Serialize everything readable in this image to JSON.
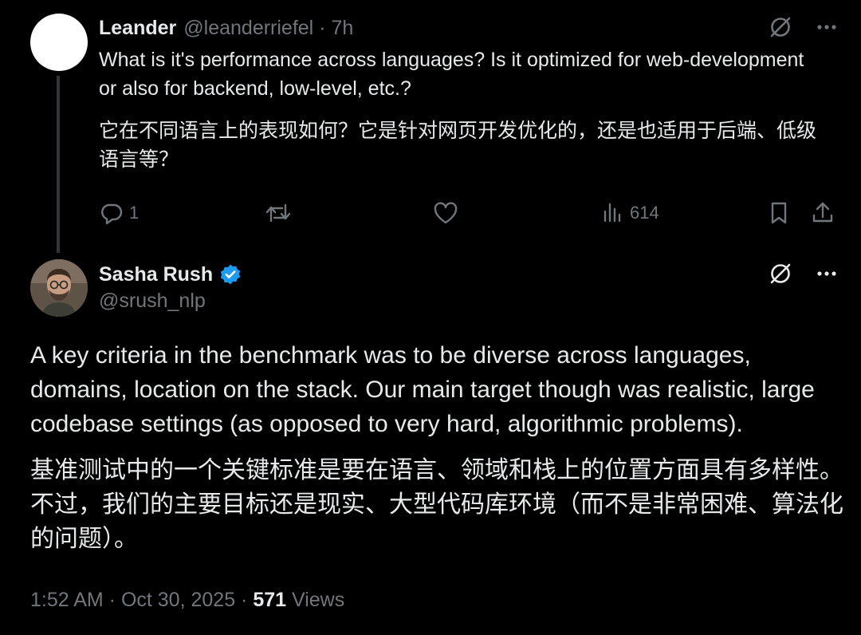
{
  "reply": {
    "author_name": "Leander",
    "author_meta": "@leanderriefel · 7h",
    "text_en": "What is it's performance across languages? Is it optimized for web-development or also for backend, low-level, etc.?",
    "text_zh": "它在不同语言上的表现如何？它是针对网页开发优化的，还是也适用于后端、低级语言等？",
    "actions": {
      "reply_count": "1",
      "retweet_count": "",
      "like_count": "",
      "views_count": "614"
    }
  },
  "tweet": {
    "author_name": "Sasha Rush",
    "author_handle": "@srush_nlp",
    "verified": true,
    "text_en": "A key criteria in the benchmark was to be diverse across languages, domains, location on the stack. Our main target though was realistic, large codebase settings (as opposed to very hard, algorithmic problems).",
    "text_zh": "基准测试中的一个关键标准是要在语言、领域和栈上的位置方面具有多样性。不过，我们的主要目标还是现实、大型代码库环境（而不是非常困难、算法化的问题）。",
    "meta_prefix": "1:52 AM · Oct 30, 2025 · ",
    "views_count": "571",
    "views_label": " Views"
  },
  "icons": {
    "grok": "grok-slash-icon",
    "more": "more-horizontal-icon",
    "reply": "reply-bubble-icon",
    "retweet": "retweet-icon",
    "like": "heart-icon",
    "views": "views-chart-icon",
    "bookmark": "bookmark-icon",
    "share": "share-icon",
    "verified": "verified-badge-icon"
  },
  "colors": {
    "background": "#000000",
    "text_primary": "#e7e9ea",
    "text_secondary": "#71767b",
    "verified_blue": "#1d9bf0",
    "thread_line": "#333639"
  }
}
